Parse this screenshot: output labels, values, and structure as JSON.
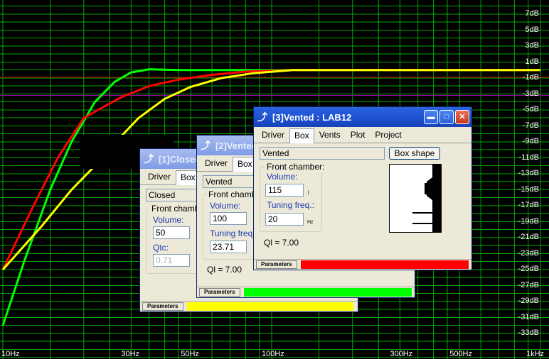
{
  "graph": {
    "y_labels": [
      "7dB",
      "5dB",
      "3dB",
      "1dB",
      "-1dB",
      "-3dB",
      "-5dB",
      "-7dB",
      "-9dB",
      "-11dB",
      "-13dB",
      "-15dB",
      "-17dB",
      "-19dB",
      "-21dB",
      "-23dB",
      "-25dB",
      "-27dB",
      "-29dB",
      "-31dB",
      "-33dB"
    ],
    "x_labels": [
      "10Hz",
      "30Hz",
      "50Hz",
      "100Hz",
      "300Hz",
      "500Hz",
      "1kHz"
    ],
    "colors": {
      "grid": "#00a800",
      "zero_line": "#c00000",
      "minus3_line": "#a000a0",
      "closed": "#ffff00",
      "vented_2": "#00ff00",
      "vented_3": "#ff0000"
    }
  },
  "window_closed": {
    "title": "[1]Closed",
    "tabs": [
      "Driver",
      "Box"
    ],
    "box_type": "Closed",
    "group_title": "Front chamber",
    "volume_label": "Volume:",
    "volume_value": "50",
    "qtc_label": "Qtc:",
    "qtc_value": "0.71",
    "status_label": "Parameters",
    "status_color": "#ffff00"
  },
  "window_vented2": {
    "title": "[2]Vented",
    "tabs": [
      "Driver",
      "Box"
    ],
    "box_type": "Vented",
    "group_title": "Front chamber",
    "volume_label": "Volume:",
    "volume_value": "100",
    "tuning_label": "Tuning freq.:",
    "tuning_value": "23.71",
    "ql": "Ql = 7.00",
    "status_label": "Parameters",
    "status_color": "#00ff00"
  },
  "window_vented3": {
    "title": "[3]Vented : LAB12",
    "tabs": [
      "Driver",
      "Box",
      "Vents",
      "Plot",
      "Project"
    ],
    "box_type": "Vented",
    "box_shape_button": "Box shape",
    "group_title": "Front chamber:",
    "volume_label": "Volume:",
    "volume_value": "115",
    "volume_unit": "l",
    "tuning_label": "Tuning freq.:",
    "tuning_value": "20",
    "tuning_unit": "Hz",
    "ql": "Ql = 7.00",
    "status_label": "Parameters",
    "status_color": "#ff0000",
    "window_buttons": [
      "minimize",
      "maximize",
      "close"
    ]
  }
}
